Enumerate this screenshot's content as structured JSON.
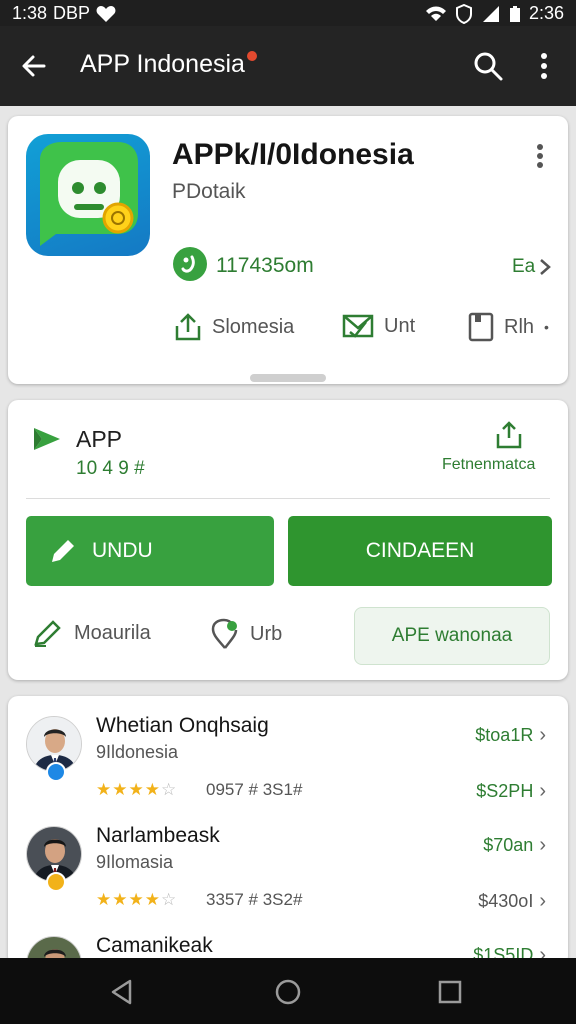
{
  "status_bar": {
    "time": "1:38",
    "carrier": "DBP",
    "clock_right": "2:36"
  },
  "app_bar": {
    "title": "APP Indonesia"
  },
  "app_info": {
    "name": "APPk/I/0Idonesia",
    "developer": "PDotaik",
    "rating_value": "117435om",
    "rating_more": "Ea",
    "actions": [
      {
        "label": "Slomesia",
        "icon": "upload-icon"
      },
      {
        "label": "Unt",
        "icon": "mail-check-icon"
      },
      {
        "label": "Rlh",
        "icon": "bookmark-icon"
      }
    ],
    "icon_color": "#1479c4"
  },
  "install_card": {
    "title": "APP",
    "count": "10 4 9 #",
    "share_label": "Fetnenmatca",
    "primary_button": "UNDU",
    "secondary_button": "CINDAEEN",
    "row": {
      "left_label": "Moaurila",
      "mid_label": "Urb",
      "tonal_button": "APE wanonaa"
    },
    "accent_color": "#38a13f"
  },
  "reviews": [
    {
      "name": "Whetian Onqhsaig",
      "location": "9Ildonesia",
      "rating": 4,
      "meta": "0957  # 3S1#",
      "price": "$toa1R",
      "price2": "$S2PH",
      "badge_color": "#1e88e5"
    },
    {
      "name": "Narlambeask",
      "location": "9Ilomasia",
      "rating": 4,
      "meta": "3357  # 3S2#",
      "price": "$70an",
      "price2": "$430oI",
      "badge_color": "#f2b21a"
    },
    {
      "name": "Camanikeak",
      "location": "",
      "rating": 0,
      "meta": "",
      "price": "$1S5ID",
      "price2": "",
      "badge_color": "#1e88e5"
    }
  ]
}
